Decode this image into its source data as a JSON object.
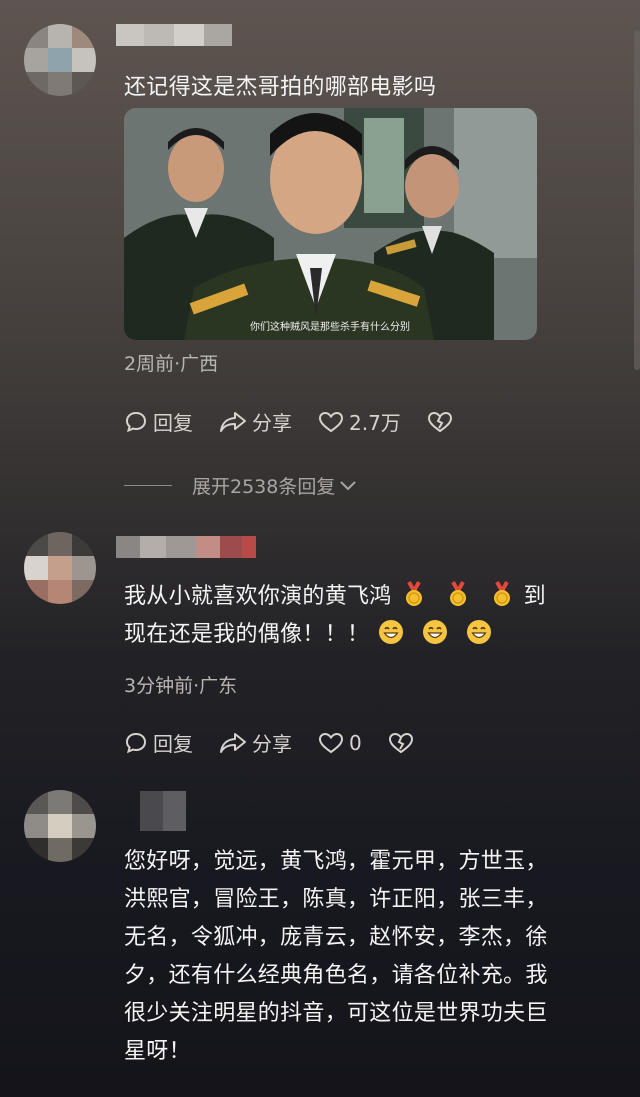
{
  "comments": [
    {
      "text": "还记得这是杰哥拍的哪部电影吗",
      "subtitle": "你们这种贼风是那些杀手有什么分别",
      "meta": "2周前·广西",
      "reply_label": "回复",
      "share_label": "分享",
      "like_count": "2.7万",
      "expand_label": "展开2538条回复"
    },
    {
      "text_line1": "我从小就喜欢你演的黄飞鸿",
      "text_line1_end": "到",
      "text_line2": "现在还是我的偶像！！！",
      "meta": "3分钟前·广东",
      "reply_label": "回复",
      "share_label": "分享",
      "like_count": "0"
    },
    {
      "lines": [
        "您好呀，觉远，黄飞鸿，霍元甲，方世玉，",
        "洪熙官，冒险王，陈真，许正阳，张三丰，",
        "无名，令狐冲，庞青云，赵怀安，李杰，徐",
        "夕，还有什么经典角色名，请各位补充。我",
        "很少关注明星的抖音，可这位是世界功夫巨",
        "星呀！"
      ]
    }
  ],
  "icons": [
    "reply-icon",
    "share-icon",
    "heart-icon",
    "dislike-heart-icon",
    "chevron-down-icon",
    "medal-emoji",
    "grin-emoji"
  ],
  "colors": {
    "text": "#f4f4f4",
    "meta": "#b9b6b2",
    "medal_gold": "#f2c02f",
    "medal_ribbon": "#e0483c"
  }
}
